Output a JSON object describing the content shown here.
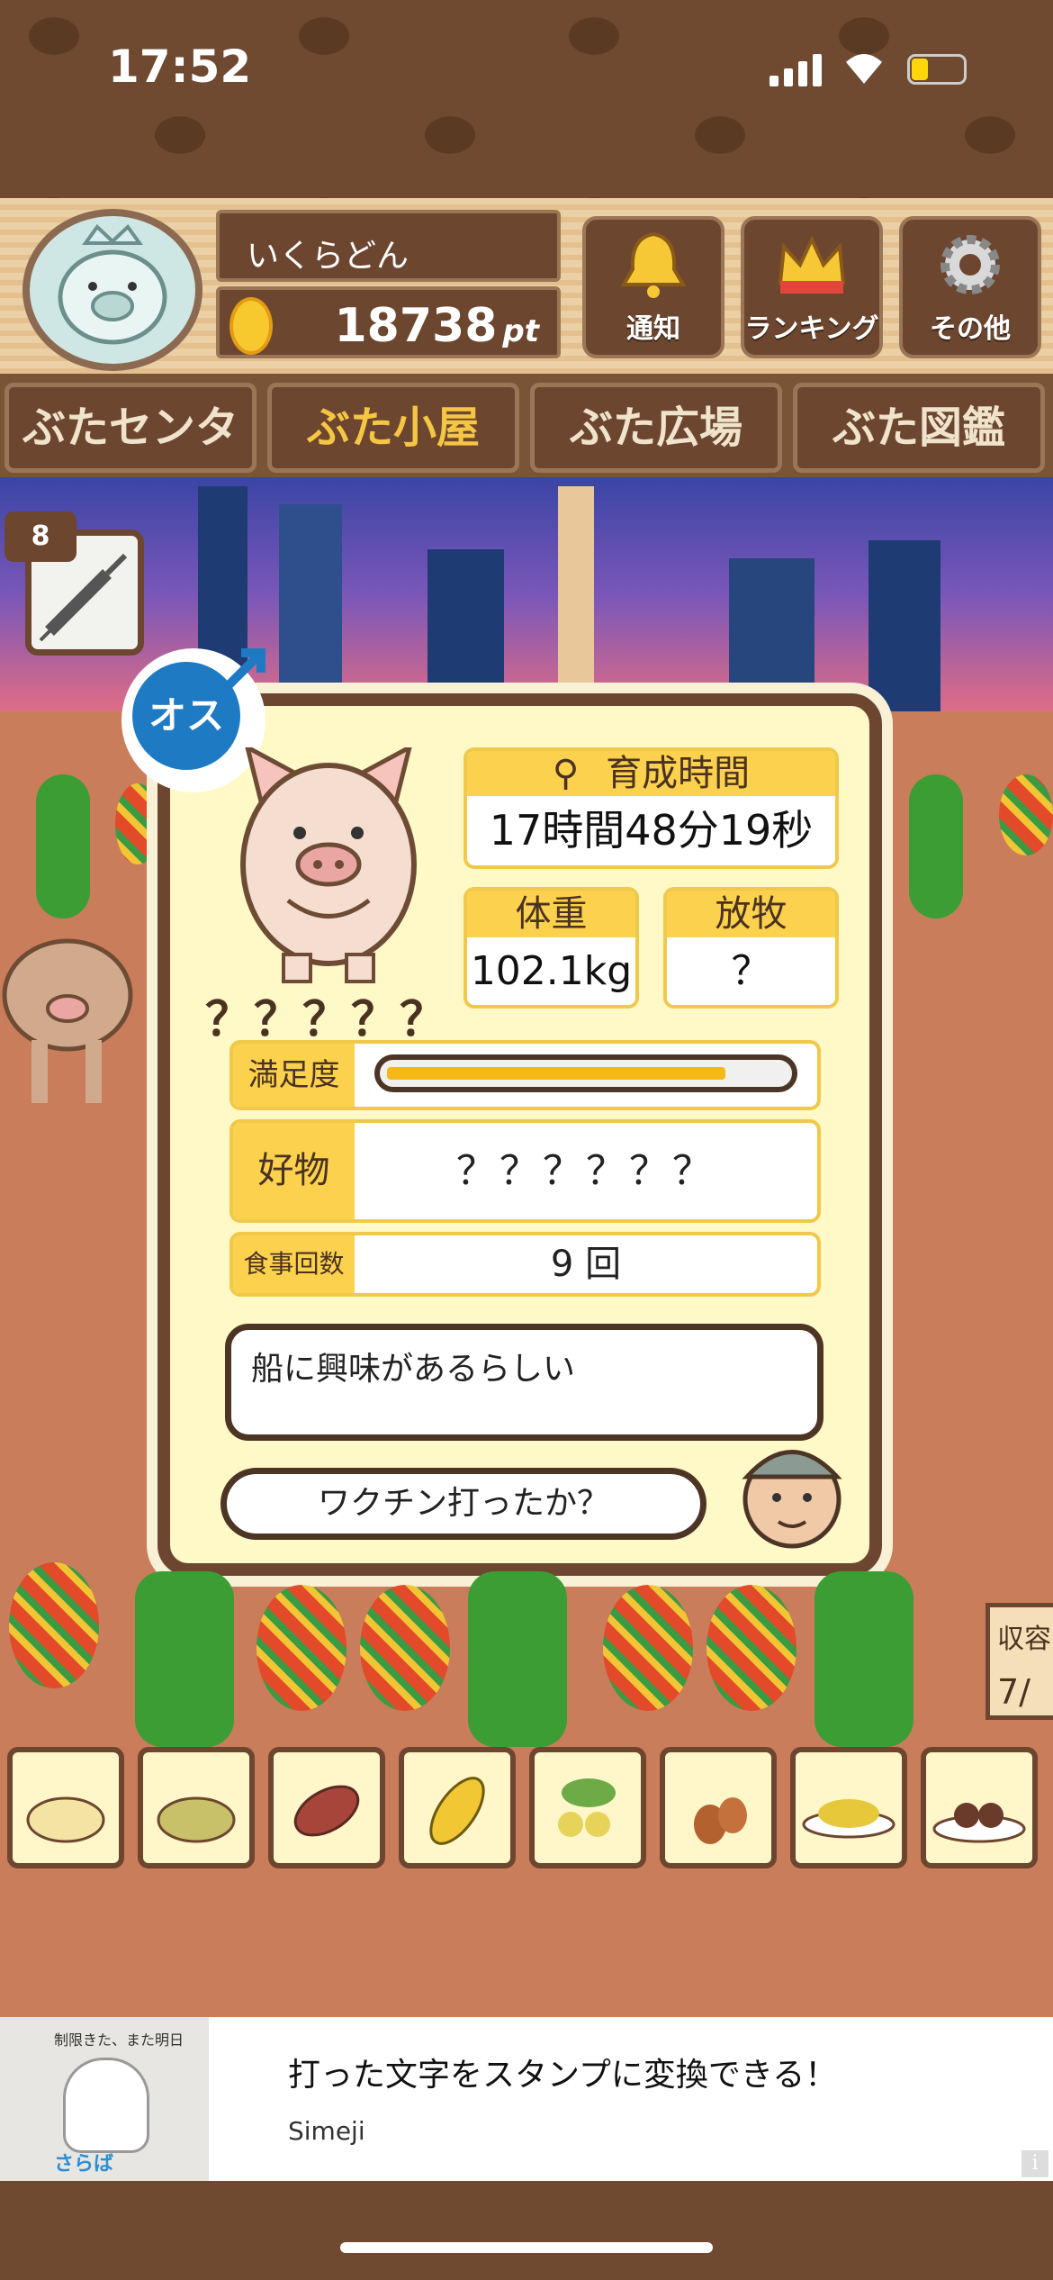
{
  "status_bar": {
    "time": "17:52"
  },
  "header": {
    "username": "いくらどん",
    "points": "18738",
    "points_unit": "pt",
    "buttons": {
      "notify": "通知",
      "ranking": "ランキング",
      "other": "その他"
    }
  },
  "tabs": [
    {
      "label": "ぶたセンター",
      "active": false
    },
    {
      "label": "ぶた小屋",
      "active": true
    },
    {
      "label": "ぶた広場",
      "active": false
    },
    {
      "label": "ぶた図鑑",
      "active": false
    }
  ],
  "syringe": {
    "count": "8"
  },
  "pig": {
    "gender_badge": "オス",
    "name": "？？？？？",
    "growth_time_label": "育成時間",
    "growth_time_value": "17時間48分19秒",
    "weight_label": "体重",
    "weight_value": "102.1kg",
    "grazing_label": "放牧",
    "grazing_value": "？",
    "satisfaction_label": "満足度",
    "satisfaction_level": 0.85,
    "favorite_label": "好物",
    "favorite_value": "？？？？？？",
    "meals_label": "食事回数",
    "meals_value": "9 回",
    "speech": "船に興味があるらしい",
    "farmer_speech": "ワクチン打ったか？"
  },
  "harvest": {
    "label": "収容",
    "count": "7/"
  },
  "foods": [
    "food-1",
    "food-2",
    "sweet-potato",
    "corn",
    "beans",
    "acorn",
    "soybeans",
    "meatballs"
  ],
  "ad": {
    "image_text_top": "制限きた、また明日",
    "image_text_bottom": "さらば",
    "title": "打った文字をスタンプに変換できる！",
    "sponsor": "Simeji"
  },
  "colors": {
    "panel_bg": "#fff8c7",
    "wood_dark": "#6d4630",
    "accent_yellow": "#fcd14d",
    "gender_blue": "#1f7ac4"
  }
}
